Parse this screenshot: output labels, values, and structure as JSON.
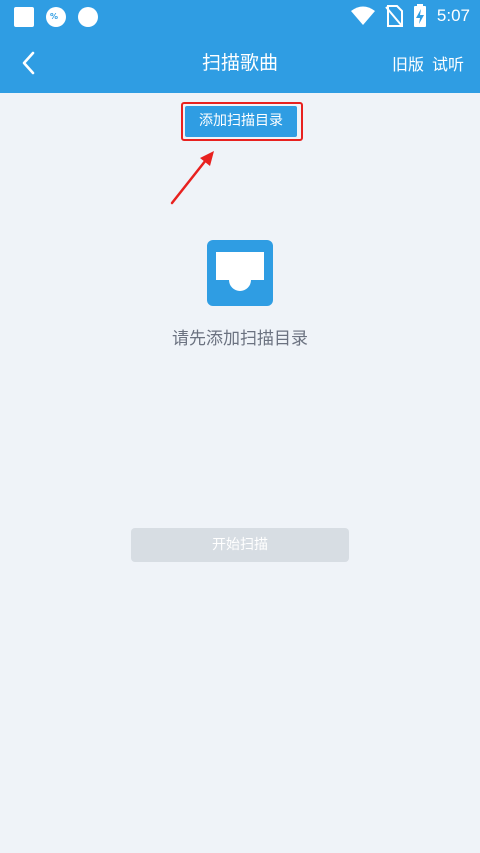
{
  "status_bar": {
    "notification_icons": [
      "square-notification-icon",
      "percent-badge-icon",
      "circle-notification-icon"
    ],
    "system_icons": [
      "wifi-icon",
      "no-sim-icon",
      "battery-charging-icon"
    ],
    "time": "5:07"
  },
  "app_bar": {
    "title": "扫描歌曲",
    "actions": [
      "旧版",
      "试听"
    ]
  },
  "main": {
    "add_directory_label": "添加扫描目录",
    "empty_message": "请先添加扫描目录",
    "start_scan_label": "开始扫描"
  },
  "colors": {
    "primary": "#2f9de3",
    "background": "#eff3f8",
    "highlight": "#e8211f",
    "disabled_button": "#d7dde3"
  }
}
